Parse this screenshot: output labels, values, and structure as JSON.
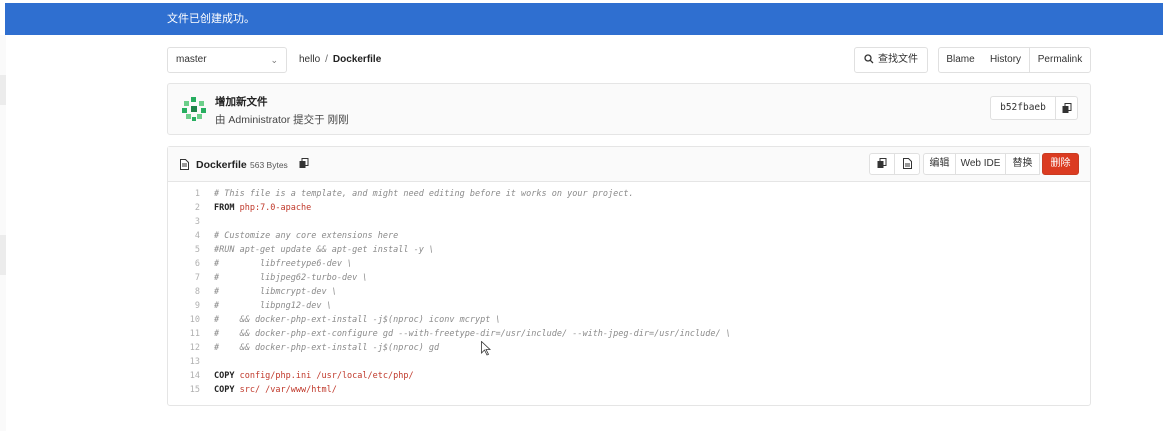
{
  "flash": {
    "message": "文件已创建成功。"
  },
  "branch": {
    "selected": "master"
  },
  "breadcrumb": {
    "project": "hello",
    "separator": "/",
    "file": "Dockerfile"
  },
  "actions": {
    "find_file": "查找文件",
    "blame": "Blame",
    "history": "History",
    "permalink": "Permalink"
  },
  "commit": {
    "title": "增加新文件",
    "meta": "由 Administrator 提交于 刚刚",
    "sha": "b52fbaeb"
  },
  "file": {
    "name": "Dockerfile",
    "size": "563 Bytes",
    "buttons": {
      "edit": "编辑",
      "web_ide": "Web IDE",
      "replace": "替换",
      "delete": "删除"
    }
  },
  "code_lines": [
    {
      "n": "1",
      "parts": [
        {
          "t": "# This file is a template, and might need editing before it works on your project.",
          "c": "c-comment"
        }
      ]
    },
    {
      "n": "2",
      "parts": [
        {
          "t": "FROM ",
          "c": "c-kw"
        },
        {
          "t": "php:7.0-apache",
          "c": "c-str"
        }
      ]
    },
    {
      "n": "3",
      "parts": []
    },
    {
      "n": "4",
      "parts": [
        {
          "t": "# Customize any core extensions here",
          "c": "c-comment"
        }
      ]
    },
    {
      "n": "5",
      "parts": [
        {
          "t": "#RUN apt-get update && apt-get install -y \\",
          "c": "c-comment"
        }
      ]
    },
    {
      "n": "6",
      "parts": [
        {
          "t": "#        libfreetype6-dev \\",
          "c": "c-comment"
        }
      ]
    },
    {
      "n": "7",
      "parts": [
        {
          "t": "#        libjpeg62-turbo-dev \\",
          "c": "c-comment"
        }
      ]
    },
    {
      "n": "8",
      "parts": [
        {
          "t": "#        libmcrypt-dev \\",
          "c": "c-comment"
        }
      ]
    },
    {
      "n": "9",
      "parts": [
        {
          "t": "#        libpng12-dev \\",
          "c": "c-comment"
        }
      ]
    },
    {
      "n": "10",
      "parts": [
        {
          "t": "#    && docker-php-ext-install -j$(nproc) iconv mcrypt \\",
          "c": "c-comment"
        }
      ]
    },
    {
      "n": "11",
      "parts": [
        {
          "t": "#    && docker-php-ext-configure gd --with-freetype-dir=/usr/include/ --with-jpeg-dir=/usr/include/ \\",
          "c": "c-comment"
        }
      ]
    },
    {
      "n": "12",
      "parts": [
        {
          "t": "#    && docker-php-ext-install -j$(nproc) gd",
          "c": "c-comment"
        }
      ]
    },
    {
      "n": "13",
      "parts": []
    },
    {
      "n": "14",
      "parts": [
        {
          "t": "COPY ",
          "c": "c-kw"
        },
        {
          "t": "config/php.ini /usr/local/etc/php/",
          "c": "c-str"
        }
      ]
    },
    {
      "n": "15",
      "parts": [
        {
          "t": "COPY ",
          "c": "c-kw"
        },
        {
          "t": "src/ /var/www/html/",
          "c": "c-str"
        }
      ]
    }
  ],
  "colors": {
    "flash_bg": "#2f6fd0",
    "delete_bg": "#db3b21",
    "string": "#c0392b",
    "comment": "#8a8a8a"
  }
}
